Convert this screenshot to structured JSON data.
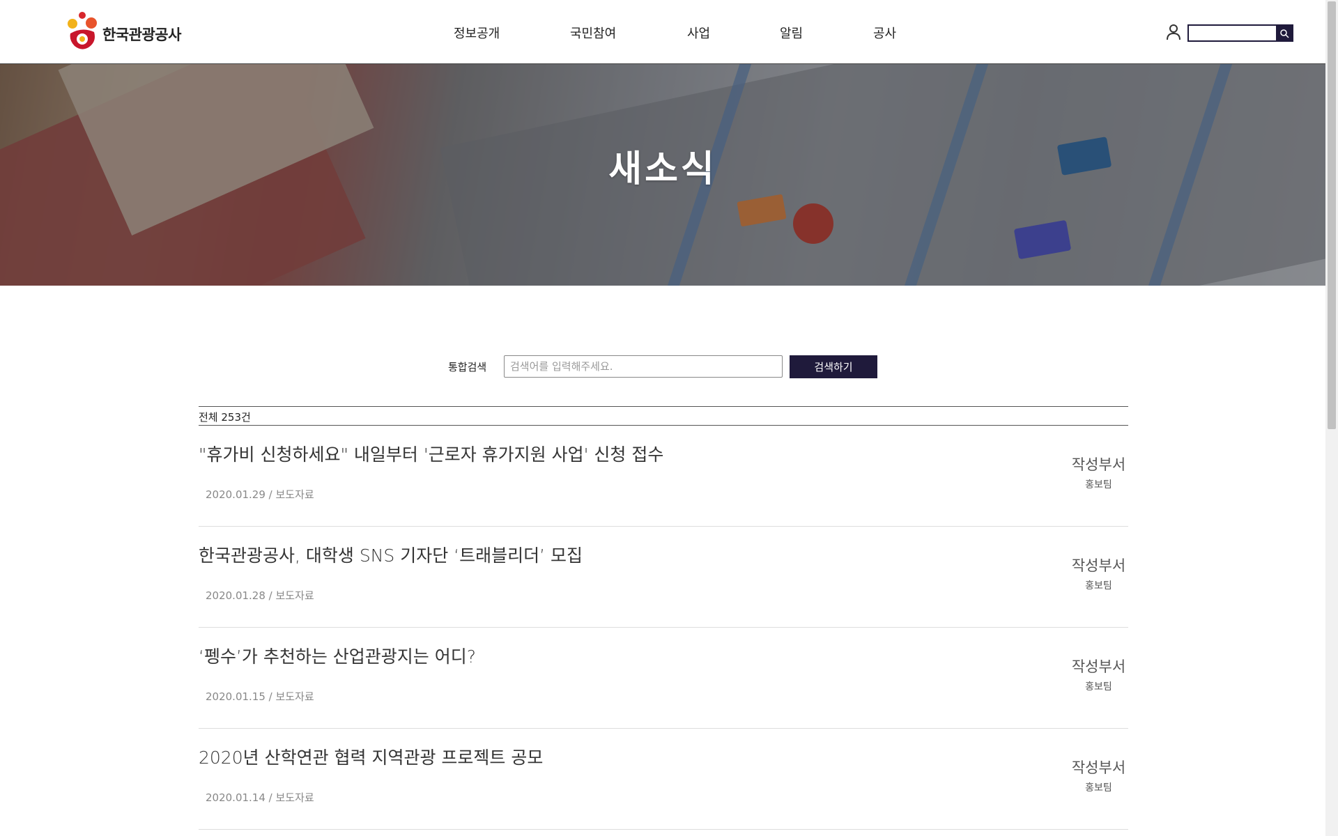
{
  "brand": {
    "name": "한국관광공사"
  },
  "nav": {
    "items": [
      "정보공개",
      "국민참여",
      "사업",
      "알림",
      "공사"
    ]
  },
  "hero": {
    "title": "새소식"
  },
  "search": {
    "label": "통합검색",
    "placeholder": "검색어를 입력해주세요.",
    "button_label": "검색하기"
  },
  "list": {
    "total_label": "전체 253건",
    "items": [
      {
        "title": "\"휴가비 신청하세요\" 내일부터 '근로자 휴가지원 사업' 신청 접수",
        "meta": "2020.01.29 / 보도자료",
        "dept_label": "작성부서",
        "dept": "홍보팀"
      },
      {
        "title": "한국관광공사, 대학생 SNS 기자단 ‘트래블리더’ 모집",
        "meta": "2020.01.28 / 보도자료",
        "dept_label": "작성부서",
        "dept": "홍보팀"
      },
      {
        "title": "‘펭수’가 추천하는 산업관광지는 어디?",
        "meta": "2020.01.15 / 보도자료",
        "dept_label": "작성부서",
        "dept": "홍보팀"
      },
      {
        "title": "2020년 산학연관 협력 지역관광 프로젝트 공모",
        "meta": "2020.01.14 / 보도자료",
        "dept_label": "작성부서",
        "dept": "홍보팀"
      }
    ]
  },
  "icons": {
    "user": "user-icon",
    "search": "search-icon"
  },
  "colors": {
    "primary": "#1f1a3b",
    "logo_red": "#d7262c",
    "logo_yellow": "#f2b21a"
  }
}
